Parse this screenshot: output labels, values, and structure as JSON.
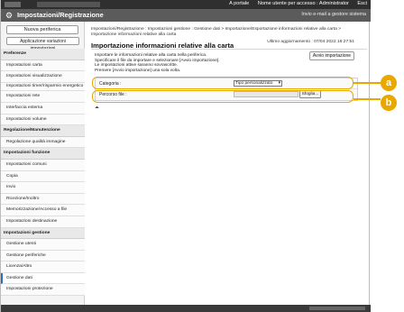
{
  "topbar": {
    "links": [
      "A portale",
      "Nome utente per accesso : Administrator",
      "Esci"
    ]
  },
  "header": {
    "title": "Impostazioni/Registrazione",
    "mail_link": "Invio e-mail a gestore sistema"
  },
  "sidebar": {
    "new_device": "Nuova periferica",
    "apply_changes": "Applicazione variazioni impostazioni",
    "items": [
      {
        "label": "Preferenze",
        "type": "head"
      },
      {
        "label": "Impostazioni carta",
        "type": "item"
      },
      {
        "label": "Impostazioni visualizzazione",
        "type": "item"
      },
      {
        "label": "Impostazioni timer/risparmio energetico",
        "type": "item"
      },
      {
        "label": "Impostazioni rete",
        "type": "item"
      },
      {
        "label": "Interfaccia esterna",
        "type": "item"
      },
      {
        "label": "Impostazioni volume",
        "type": "item"
      },
      {
        "label": "Regolazione/Manutenzione",
        "type": "head"
      },
      {
        "label": "Regolazione qualità immagine",
        "type": "item"
      },
      {
        "label": "Impostazioni funzione",
        "type": "head"
      },
      {
        "label": "Impostazioni comuni",
        "type": "item"
      },
      {
        "label": "Copia",
        "type": "item"
      },
      {
        "label": "Invio",
        "type": "item"
      },
      {
        "label": "Ricezione/Inoltro",
        "type": "item"
      },
      {
        "label": "Memorizzazione/Accesso a file",
        "type": "item"
      },
      {
        "label": "Impostazioni destinazione",
        "type": "item"
      },
      {
        "label": "Impostazioni gestione",
        "type": "head"
      },
      {
        "label": "Gestione utenti",
        "type": "item"
      },
      {
        "label": "Gestione periferiche",
        "type": "item"
      },
      {
        "label": "Licenza/Altro",
        "type": "item"
      },
      {
        "label": "Gestione dati",
        "type": "selected"
      },
      {
        "label": "Impostazioni protezione",
        "type": "item"
      }
    ]
  },
  "main": {
    "breadcrumb": "Impostazioni/Registrazione : Impostazioni gestione : Gestione dati > Importazione/Esportazione informazioni relative alla carta > Importazione informazioni relative alla carta",
    "title": "Importazione informazioni relative alla carta",
    "updated": "Ultimo aggiornamento : 07/04 2022 16:27:51",
    "description": [
      "Importare le informazioni relative alla carta nella periferica.",
      "Specificare il file da importare e selezionare [Avvio importazione].",
      "Le impostazioni attive saranno sovrascritte.",
      "Premere [Avvio importazione] una sola volta."
    ],
    "start_import": "Avvio importazione",
    "category_label": "Categoria :",
    "category_value": "Tipo personalizzato",
    "file_path_label": "Percorso file :",
    "browse_label": "Sfoglia..."
  },
  "callouts": {
    "a": "a",
    "b": "b"
  },
  "colors": {
    "accent": "#e9a800",
    "header_bg": "#5b5b5b",
    "topbar_bg": "#2f2f2f"
  }
}
